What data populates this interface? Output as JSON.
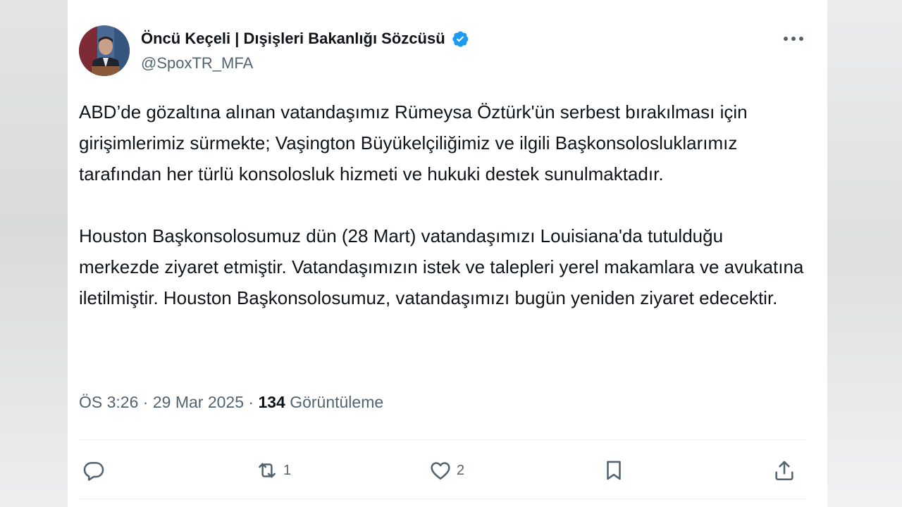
{
  "author": {
    "display_name": "Öncü Keçeli | Dışişleri Bakanlığı Sözcüsü",
    "handle": "@SpoxTR_MFA",
    "verified_icon": "verified-badge-icon",
    "verified_color": "#1d9bf0"
  },
  "tweet": {
    "paragraphs": [
      "ABD’de gözaltına alınan vatandaşımız Rümeysa Öztürk'ün serbest bırakılması için girişimlerimiz sürmekte; Vaşington Büyükelçiliğimiz ve ilgili Başkonsolosluklarımız tarafından her türlü konsolosluk hizmeti ve hukuki destek sunulmaktadır.",
      "Houston Başkonsolosumuz dün (28 Mart) vatandaşımızı Louisiana'da tutulduğu merkezde ziyaret etmiştir. Vatandaşımızın istek ve talepleri yerel makamlara ve avukatına iletilmiştir. Houston Başkonsolosumuz, vatandaşımızı bugün yeniden ziyaret edecektir."
    ],
    "time": "ÖS 3:26",
    "date": "29 Mar 2025",
    "separator": "·",
    "views_count": "134",
    "views_label": "Görüntüleme"
  },
  "actions": {
    "reply": {
      "icon": "reply-icon",
      "count": ""
    },
    "retweet": {
      "icon": "retweet-icon",
      "count": "1"
    },
    "like": {
      "icon": "heart-icon",
      "count": "2"
    },
    "bookmark": {
      "icon": "bookmark-icon",
      "count": ""
    },
    "share": {
      "icon": "share-icon",
      "count": ""
    }
  },
  "colors": {
    "text_primary": "#0f1419",
    "text_secondary": "#536471",
    "accent": "#1d9bf0"
  }
}
